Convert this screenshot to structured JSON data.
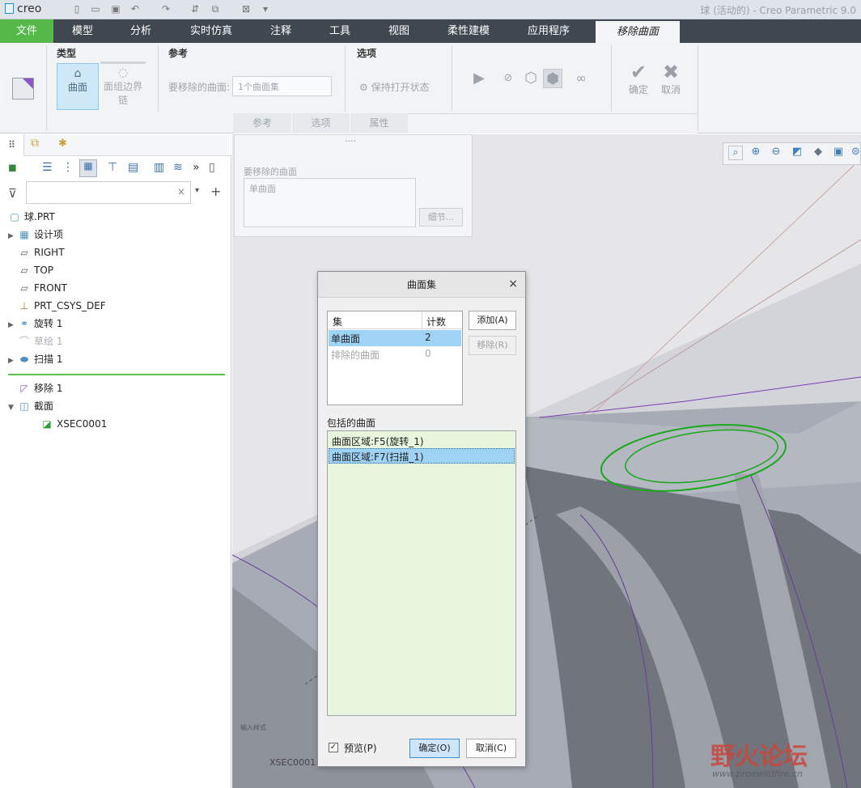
{
  "titlebar": {
    "logo": "creo",
    "window_title": "球 (活动的) - Creo Parametric 9.0"
  },
  "ribbon_tabs": {
    "file": "文件",
    "items": [
      "模型",
      "分析",
      "实时仿真",
      "注释",
      "工具",
      "视图",
      "柔性建模",
      "应用程序"
    ],
    "active": "移除曲面"
  },
  "ribbon": {
    "type_group": "类型",
    "surface_btn": "曲面",
    "edge_btn_line1": "面组边界",
    "edge_btn_line2": "链",
    "refs_group": "参考",
    "refs_label": "要移除的曲面:",
    "refs_value": "1个曲面集",
    "options_group": "选项",
    "keep_open": "保持打开状态",
    "ok": "确定",
    "cancel": "取消",
    "subtabs": [
      "参考",
      "选项",
      "属性"
    ]
  },
  "tree": {
    "search_placeholder": "",
    "items": [
      {
        "label": "球.PRT"
      },
      {
        "label": "设计项"
      },
      {
        "label": "RIGHT"
      },
      {
        "label": "TOP"
      },
      {
        "label": "FRONT"
      },
      {
        "label": "PRT_CSYS_DEF"
      },
      {
        "label": "旋转 1"
      },
      {
        "label": "草绘 1"
      },
      {
        "label": "扫描 1"
      },
      {
        "label": "移除 1"
      },
      {
        "label": "截面"
      },
      {
        "label": "XSEC0001"
      }
    ]
  },
  "panel": {
    "grip": "....",
    "label": "要移除的曲面",
    "value": "单曲面",
    "details_btn": "细节..."
  },
  "dialog": {
    "title": "曲面集",
    "close": "×",
    "col_set": "集",
    "col_count": "计数",
    "rows": [
      {
        "set": "单曲面",
        "count": "2"
      },
      {
        "set": "排除的曲面",
        "count": "0"
      }
    ],
    "add_btn": "添加(A)",
    "remove_btn": "移除(R)",
    "included_label": "包括的曲面",
    "included": [
      "曲面区域:F5(旋转_1)",
      "曲面区域:F7(扫描_1)"
    ],
    "preview": "预览(P)",
    "ok": "确定(O)",
    "cancel": "取消(C)"
  },
  "viewport": {
    "section_label": "XSEC0001",
    "note_label": "输入样式"
  },
  "watermark": {
    "text": "野火论坛",
    "url": "www.proewildfire.cn"
  }
}
